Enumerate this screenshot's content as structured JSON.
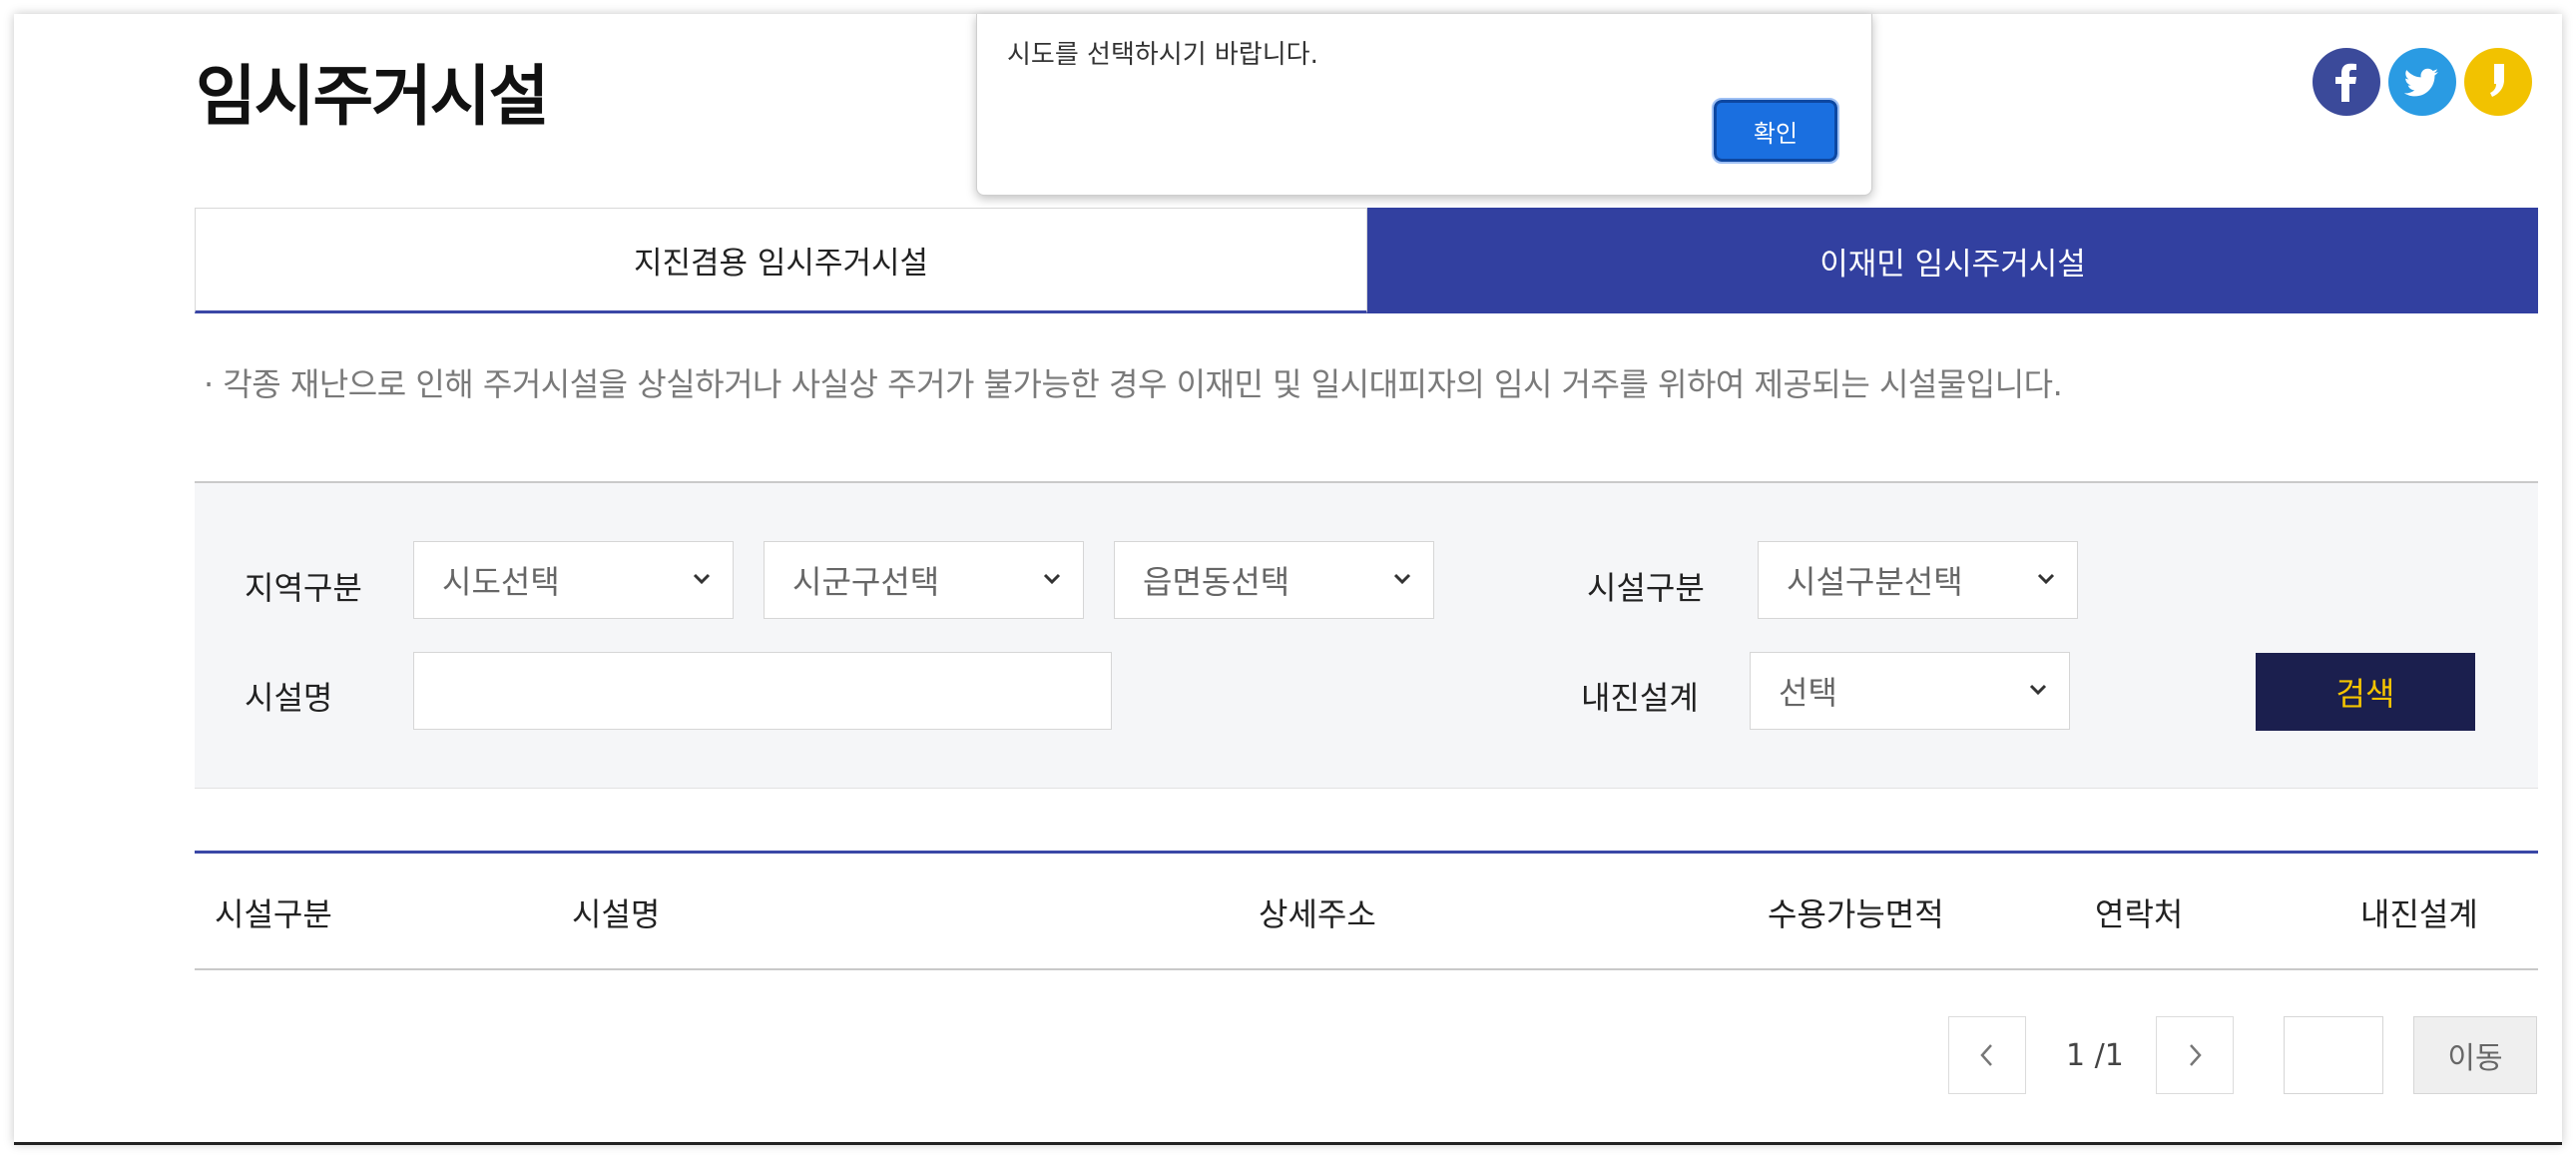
{
  "page": {
    "title": "임시주거시설"
  },
  "social": {
    "icons": [
      "facebook-icon",
      "twitter-icon",
      "kakaostory-icon"
    ],
    "colors": {
      "facebook": "#3b4a9a",
      "twitter": "#2a9be3",
      "kakaostory": "#f2c200"
    }
  },
  "tabs": [
    {
      "label": "지진겸용 임시주거시설",
      "active": false
    },
    {
      "label": "이재민 임시주거시설",
      "active": true
    }
  ],
  "description": "· 각종 재난으로 인해 주거시설을 상실하거나 사실상 주거가 불가능한 경우 이재민 및 일시대피자의 임시 거주를 위하여 제공되는 시설물입니다.",
  "search": {
    "region_label": "지역구분",
    "sido": "시도선택",
    "sigungu": "시군구선택",
    "eupmyeondong": "읍면동선택",
    "facility_type_label": "시설구분",
    "facility_type": "시설구분선택",
    "facility_name_label": "시설명",
    "facility_name_value": "",
    "seismic_label": "내진설계",
    "seismic": "선택",
    "button": "검색"
  },
  "table": {
    "headers": [
      "시설구분",
      "시설명",
      "상세주소",
      "수용가능면적",
      "연락처",
      "내진설계"
    ],
    "rows": []
  },
  "pagination": {
    "current": "1 /1",
    "move_button": "이동",
    "page_input": ""
  },
  "dialog": {
    "message": "시도를 선택하시기 바랍니다.",
    "ok_label": "확인"
  },
  "colors": {
    "accent": "#3240a0",
    "search_button": "#1b1f4e",
    "search_button_text": "#f5c400",
    "dialog_button": "#1a6fe0"
  }
}
